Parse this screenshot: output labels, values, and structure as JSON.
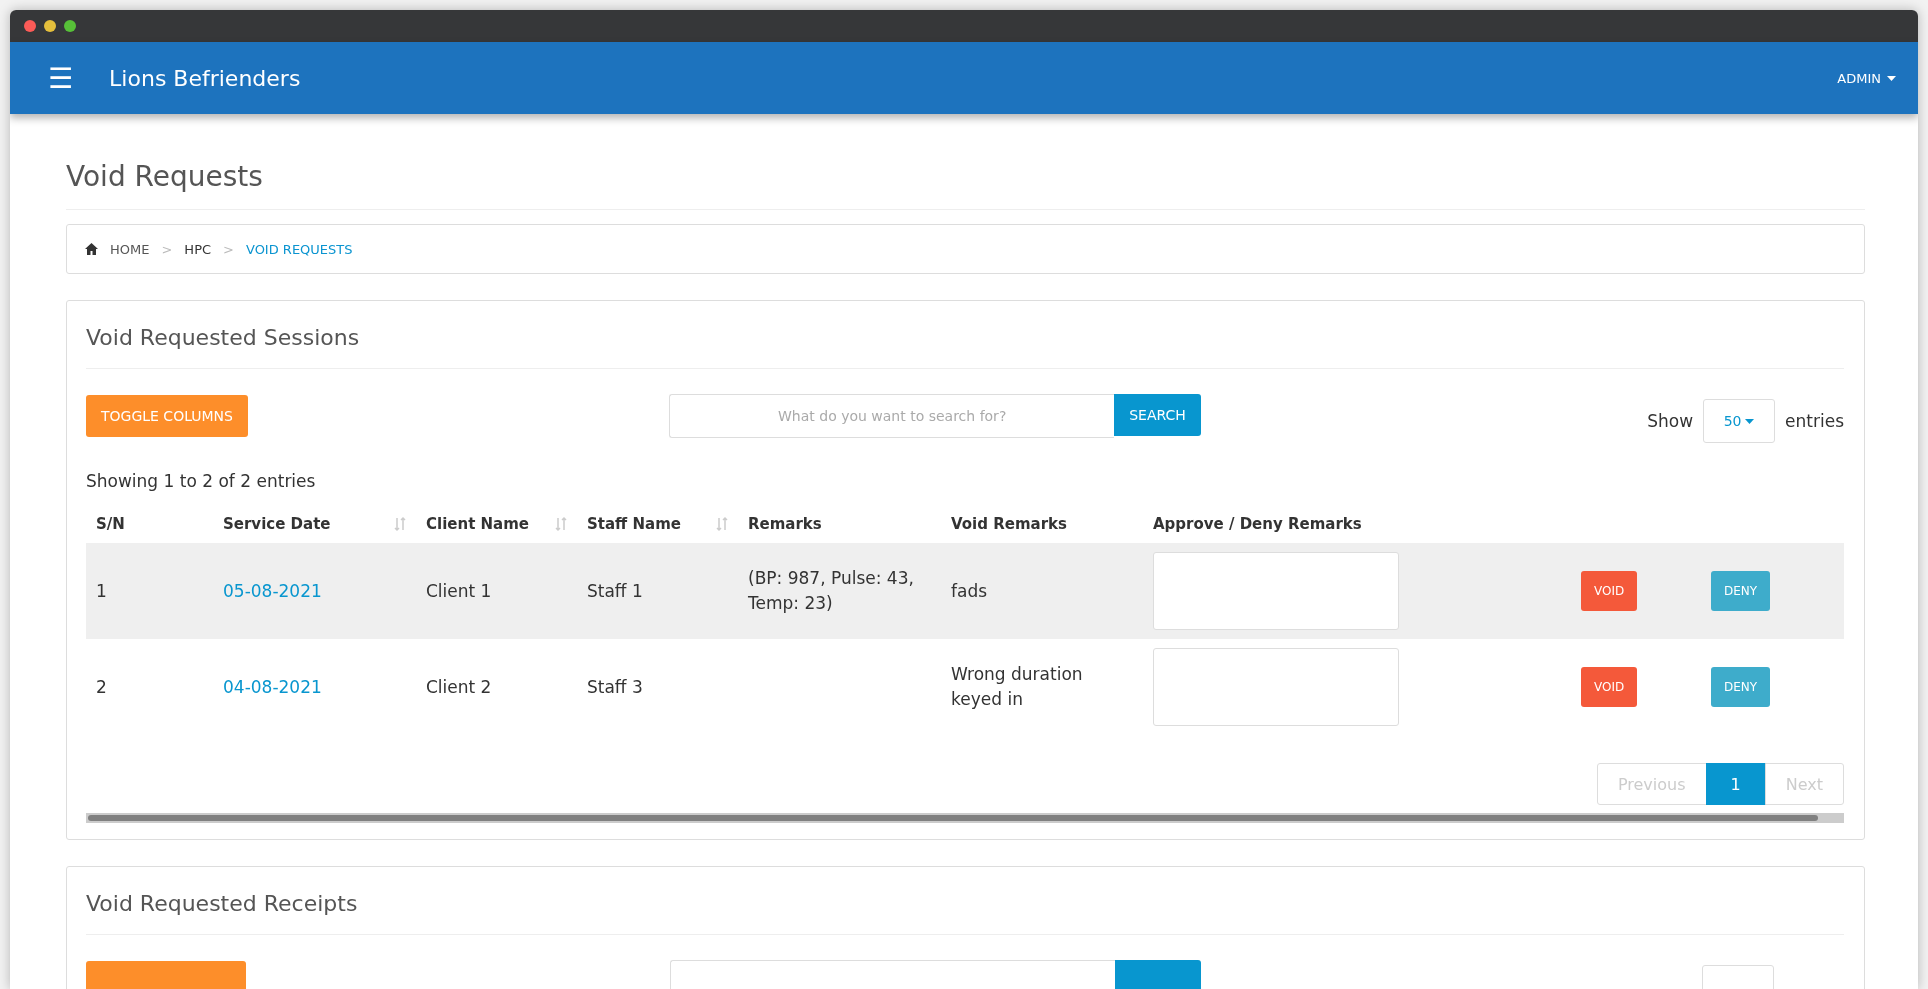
{
  "window": {
    "controls": [
      {
        "color": "#fc5b57"
      },
      {
        "color": "#e5bf3c"
      },
      {
        "color": "#57c038"
      }
    ]
  },
  "navbar": {
    "menu_icon": "☰",
    "brand": "Lions Befrienders",
    "user": "ADMIN"
  },
  "page_title": "Void Requests",
  "breadcrumb": [
    {
      "label": "HOME",
      "selected": false
    },
    {
      "label": "HPC",
      "selected": false
    },
    {
      "label": "VOID REQUESTS",
      "selected": true
    }
  ],
  "breadcrumb_separator": ">",
  "sessions": {
    "title": "Void Requested Sessions",
    "toggle_button": "TOGGLE COLUMNS",
    "search": {
      "placeholder": "What do you want to search for?",
      "button": "SEARCH"
    },
    "show_label": "Show",
    "page_size": "50",
    "entries_label": "entries",
    "info": "Showing 1 to 2 of 2 entries",
    "columns": [
      {
        "label": "S/N",
        "sortable": false
      },
      {
        "label": "Service Date",
        "sortable": true
      },
      {
        "label": "Client Name",
        "sortable": true
      },
      {
        "label": "Staff Name",
        "sortable": true
      },
      {
        "label": "Remarks",
        "sortable": false
      },
      {
        "label": "Void Remarks",
        "sortable": false
      },
      {
        "label": "Approve / Deny Remarks",
        "sortable": false
      }
    ],
    "rows": [
      {
        "sn": "1",
        "service_date": "05-08-2021",
        "client": "Client 1",
        "staff": "Staff 1",
        "remarks": "(BP: 987, Pulse: 43, Temp: 23)",
        "void_remarks": "fads",
        "void_button": "VOID",
        "deny_button": "DENY"
      },
      {
        "sn": "2",
        "service_date": "04-08-2021",
        "client": "Client 2",
        "staff": "Staff 3",
        "void_remarks": "Wrong duration keyed in",
        "void_button": "VOID",
        "deny_button": "DENY"
      }
    ],
    "pagination": [
      {
        "label": "Previous",
        "disabled": true,
        "selected": false
      },
      {
        "label": "1",
        "disabled": false,
        "selected": true
      },
      {
        "label": "Next",
        "disabled": true,
        "selected": false
      }
    ]
  },
  "receipts": {
    "title": "Void Requested Receipts"
  }
}
